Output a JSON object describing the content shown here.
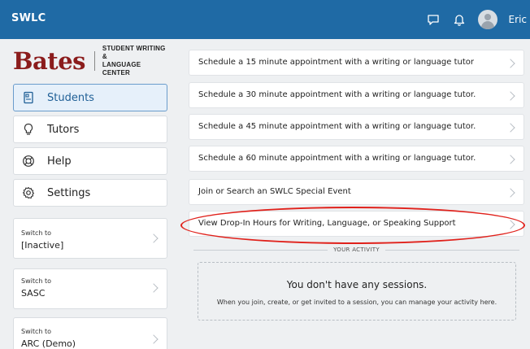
{
  "header": {
    "app_title": "SWLC",
    "user_name": "Eric",
    "icons": [
      "chat-icon",
      "bell-icon",
      "avatar-icon"
    ]
  },
  "sidebar": {
    "logo_wordmark": "Bates",
    "logo_subtitle_line1": "STUDENT WRITING &",
    "logo_subtitle_line2": "LANGUAGE CENTER",
    "nav": [
      {
        "label": "Students",
        "icon": "id-card-icon",
        "active": true
      },
      {
        "label": "Tutors",
        "icon": "lightbulb-icon",
        "active": false
      },
      {
        "label": "Help",
        "icon": "lifebuoy-icon",
        "active": false
      },
      {
        "label": "Settings",
        "icon": "gear-icon",
        "active": false
      }
    ],
    "switch_cards": [
      {
        "prefix": "Switch to",
        "name": "[Inactive]"
      },
      {
        "prefix": "Switch to",
        "name": "SASC"
      },
      {
        "prefix": "Switch to",
        "name": "ARC (Demo)"
      }
    ]
  },
  "main": {
    "appointments": [
      {
        "label": "Schedule a 15 minute appointment with a writing or language tutor"
      },
      {
        "label": "Schedule a 30 minute appointment with a writing or language tutor."
      },
      {
        "label": "Schedule a 45 minute appointment with a writing or language tutor."
      },
      {
        "label": "Schedule a 60 minute appointment with a writing or language tutor."
      },
      {
        "label": "Join or Search an SWLC Special Event"
      },
      {
        "label": "View Drop-In Hours for Writing, Language, or Speaking Support"
      }
    ],
    "activity_heading": "YOUR ACTIVITY",
    "empty_title": "You don't have any sessions.",
    "empty_subtitle": "When you join, create, or get invited to a session, you can manage your activity here."
  },
  "colors": {
    "topbar": "#1f6aa5",
    "brand_red": "#8b1c1c",
    "annotation_red": "#e0211b",
    "active_nav_bg": "#e6f0fa"
  }
}
